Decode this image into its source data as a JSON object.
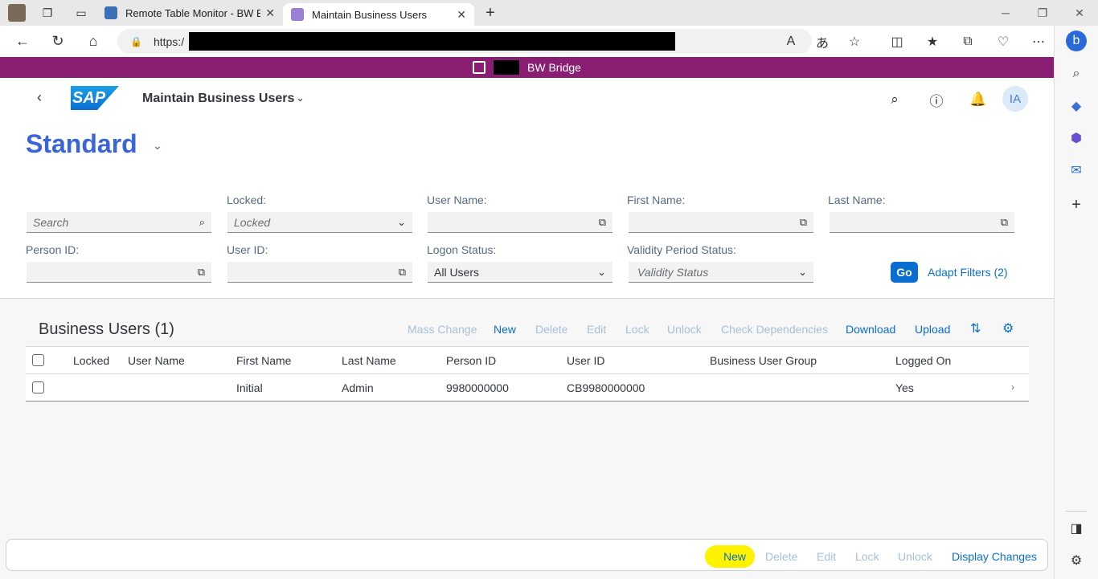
{
  "browser": {
    "tabs": [
      {
        "title": "Remote Table Monitor - BW Brid",
        "active": false
      },
      {
        "title": "Maintain Business Users",
        "active": true
      }
    ],
    "url_prefix": "https:/"
  },
  "shell": {
    "system_name": "BW Bridge"
  },
  "header": {
    "app_title": "Maintain Business Users",
    "user_initials": "IA",
    "variant": "Standard"
  },
  "filters": {
    "search_placeholder": "Search",
    "locked_label": "Locked:",
    "locked_placeholder": "Locked",
    "user_name_label": "User Name:",
    "first_name_label": "First Name:",
    "last_name_label": "Last Name:",
    "person_id_label": "Person ID:",
    "user_id_label": "User ID:",
    "logon_status_label": "Logon Status:",
    "logon_status_value": "All Users",
    "validity_label": "Validity Period Status:",
    "validity_placeholder": "Validity Status",
    "go_label": "Go",
    "adapt_filters_label": "Adapt Filters (2)"
  },
  "table": {
    "title": "Business Users (1)",
    "toolbar": {
      "mass_change": "Mass Change",
      "new": "New",
      "delete": "Delete",
      "edit": "Edit",
      "lock": "Lock",
      "unlock": "Unlock",
      "check_dependencies": "Check Dependencies",
      "download": "Download",
      "upload": "Upload"
    },
    "columns": {
      "locked": "Locked",
      "user_name": "User Name",
      "first_name": "First Name",
      "last_name": "Last Name",
      "person_id": "Person ID",
      "user_id": "User ID",
      "business_user_group": "Business User Group",
      "logged_on": "Logged On"
    },
    "rows": [
      {
        "locked": "",
        "user_name": "",
        "first_name": "Initial",
        "last_name": "Admin",
        "person_id": "9980000000",
        "user_id": "CB9980000000",
        "business_user_group": "",
        "logged_on": "Yes"
      }
    ]
  },
  "footer": {
    "new": "New",
    "delete": "Delete",
    "edit": "Edit",
    "lock": "Lock",
    "unlock": "Unlock",
    "display_changes": "Display Changes"
  },
  "colors": {
    "shell_bar": "#8a1e73",
    "accent": "#0a6ed1",
    "variant_title": "#3a65d6",
    "highlight": "#fff200"
  }
}
